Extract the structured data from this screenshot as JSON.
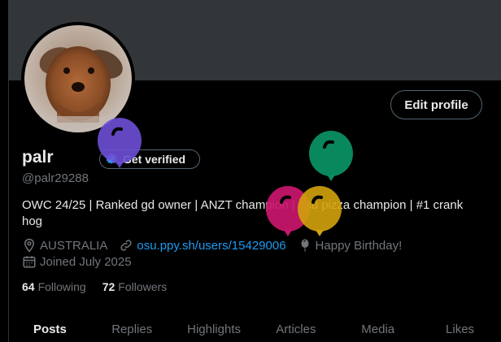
{
  "profile": {
    "name": "palr",
    "handle": "@palr29288",
    "bio": "OWC 24/25 | Ranked gd owner | ANZT champion | osu pizza champion | #1 crank hog",
    "location": "AUSTRALIA",
    "website": "osu.ppy.sh/users/15429006",
    "birthday": "Happy Birthday!",
    "joined": "Joined July 2025",
    "following_count": "64",
    "following_label": "Following",
    "followers_count": "72",
    "followers_label": "Followers"
  },
  "buttons": {
    "edit_profile": "Edit profile",
    "get_verified": "Get verified"
  },
  "tabs": [
    "Posts",
    "Replies",
    "Highlights",
    "Articles",
    "Media",
    "Likes"
  ],
  "active_tab": "Posts",
  "colors": {
    "banner": "#333639",
    "link": "#1d9bf0",
    "balloon_purple": "#6d4fd6",
    "balloon_green": "#0a8f62",
    "balloon_pink": "#c9176c",
    "balloon_yellow": "#d3a20c"
  },
  "icons": [
    "location-pin-icon",
    "link-icon",
    "balloon-icon",
    "calendar-icon",
    "verified-badge-icon"
  ]
}
